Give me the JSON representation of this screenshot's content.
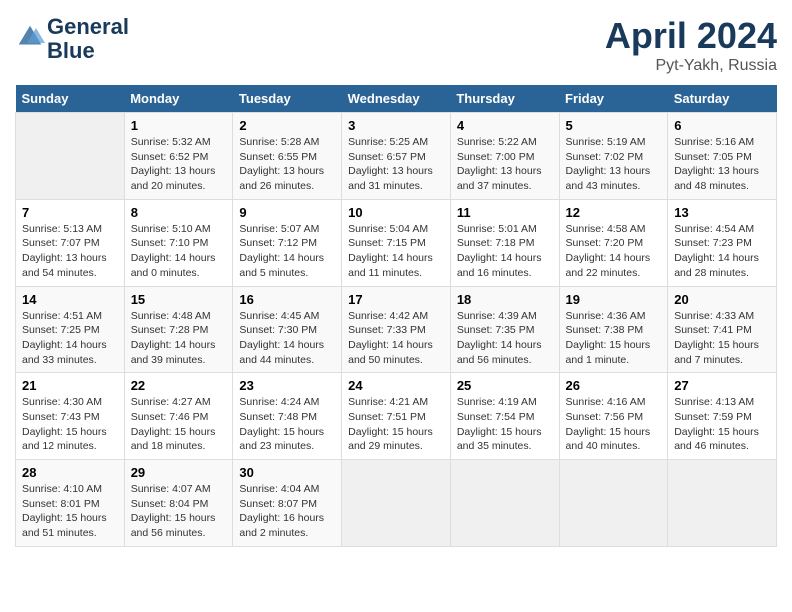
{
  "header": {
    "logo_line1": "General",
    "logo_line2": "Blue",
    "main_title": "April 2024",
    "sub_title": "Pyt-Yakh, Russia"
  },
  "days_of_week": [
    "Sunday",
    "Monday",
    "Tuesday",
    "Wednesday",
    "Thursday",
    "Friday",
    "Saturday"
  ],
  "weeks": [
    [
      {
        "day": "",
        "info": ""
      },
      {
        "day": "1",
        "info": "Sunrise: 5:32 AM\nSunset: 6:52 PM\nDaylight: 13 hours\nand 20 minutes."
      },
      {
        "day": "2",
        "info": "Sunrise: 5:28 AM\nSunset: 6:55 PM\nDaylight: 13 hours\nand 26 minutes."
      },
      {
        "day": "3",
        "info": "Sunrise: 5:25 AM\nSunset: 6:57 PM\nDaylight: 13 hours\nand 31 minutes."
      },
      {
        "day": "4",
        "info": "Sunrise: 5:22 AM\nSunset: 7:00 PM\nDaylight: 13 hours\nand 37 minutes."
      },
      {
        "day": "5",
        "info": "Sunrise: 5:19 AM\nSunset: 7:02 PM\nDaylight: 13 hours\nand 43 minutes."
      },
      {
        "day": "6",
        "info": "Sunrise: 5:16 AM\nSunset: 7:05 PM\nDaylight: 13 hours\nand 48 minutes."
      }
    ],
    [
      {
        "day": "7",
        "info": "Sunrise: 5:13 AM\nSunset: 7:07 PM\nDaylight: 13 hours\nand 54 minutes."
      },
      {
        "day": "8",
        "info": "Sunrise: 5:10 AM\nSunset: 7:10 PM\nDaylight: 14 hours\nand 0 minutes."
      },
      {
        "day": "9",
        "info": "Sunrise: 5:07 AM\nSunset: 7:12 PM\nDaylight: 14 hours\nand 5 minutes."
      },
      {
        "day": "10",
        "info": "Sunrise: 5:04 AM\nSunset: 7:15 PM\nDaylight: 14 hours\nand 11 minutes."
      },
      {
        "day": "11",
        "info": "Sunrise: 5:01 AM\nSunset: 7:18 PM\nDaylight: 14 hours\nand 16 minutes."
      },
      {
        "day": "12",
        "info": "Sunrise: 4:58 AM\nSunset: 7:20 PM\nDaylight: 14 hours\nand 22 minutes."
      },
      {
        "day": "13",
        "info": "Sunrise: 4:54 AM\nSunset: 7:23 PM\nDaylight: 14 hours\nand 28 minutes."
      }
    ],
    [
      {
        "day": "14",
        "info": "Sunrise: 4:51 AM\nSunset: 7:25 PM\nDaylight: 14 hours\nand 33 minutes."
      },
      {
        "day": "15",
        "info": "Sunrise: 4:48 AM\nSunset: 7:28 PM\nDaylight: 14 hours\nand 39 minutes."
      },
      {
        "day": "16",
        "info": "Sunrise: 4:45 AM\nSunset: 7:30 PM\nDaylight: 14 hours\nand 44 minutes."
      },
      {
        "day": "17",
        "info": "Sunrise: 4:42 AM\nSunset: 7:33 PM\nDaylight: 14 hours\nand 50 minutes."
      },
      {
        "day": "18",
        "info": "Sunrise: 4:39 AM\nSunset: 7:35 PM\nDaylight: 14 hours\nand 56 minutes."
      },
      {
        "day": "19",
        "info": "Sunrise: 4:36 AM\nSunset: 7:38 PM\nDaylight: 15 hours\nand 1 minute."
      },
      {
        "day": "20",
        "info": "Sunrise: 4:33 AM\nSunset: 7:41 PM\nDaylight: 15 hours\nand 7 minutes."
      }
    ],
    [
      {
        "day": "21",
        "info": "Sunrise: 4:30 AM\nSunset: 7:43 PM\nDaylight: 15 hours\nand 12 minutes."
      },
      {
        "day": "22",
        "info": "Sunrise: 4:27 AM\nSunset: 7:46 PM\nDaylight: 15 hours\nand 18 minutes."
      },
      {
        "day": "23",
        "info": "Sunrise: 4:24 AM\nSunset: 7:48 PM\nDaylight: 15 hours\nand 23 minutes."
      },
      {
        "day": "24",
        "info": "Sunrise: 4:21 AM\nSunset: 7:51 PM\nDaylight: 15 hours\nand 29 minutes."
      },
      {
        "day": "25",
        "info": "Sunrise: 4:19 AM\nSunset: 7:54 PM\nDaylight: 15 hours\nand 35 minutes."
      },
      {
        "day": "26",
        "info": "Sunrise: 4:16 AM\nSunset: 7:56 PM\nDaylight: 15 hours\nand 40 minutes."
      },
      {
        "day": "27",
        "info": "Sunrise: 4:13 AM\nSunset: 7:59 PM\nDaylight: 15 hours\nand 46 minutes."
      }
    ],
    [
      {
        "day": "28",
        "info": "Sunrise: 4:10 AM\nSunset: 8:01 PM\nDaylight: 15 hours\nand 51 minutes."
      },
      {
        "day": "29",
        "info": "Sunrise: 4:07 AM\nSunset: 8:04 PM\nDaylight: 15 hours\nand 56 minutes."
      },
      {
        "day": "30",
        "info": "Sunrise: 4:04 AM\nSunset: 8:07 PM\nDaylight: 16 hours\nand 2 minutes."
      },
      {
        "day": "",
        "info": ""
      },
      {
        "day": "",
        "info": ""
      },
      {
        "day": "",
        "info": ""
      },
      {
        "day": "",
        "info": ""
      }
    ]
  ]
}
